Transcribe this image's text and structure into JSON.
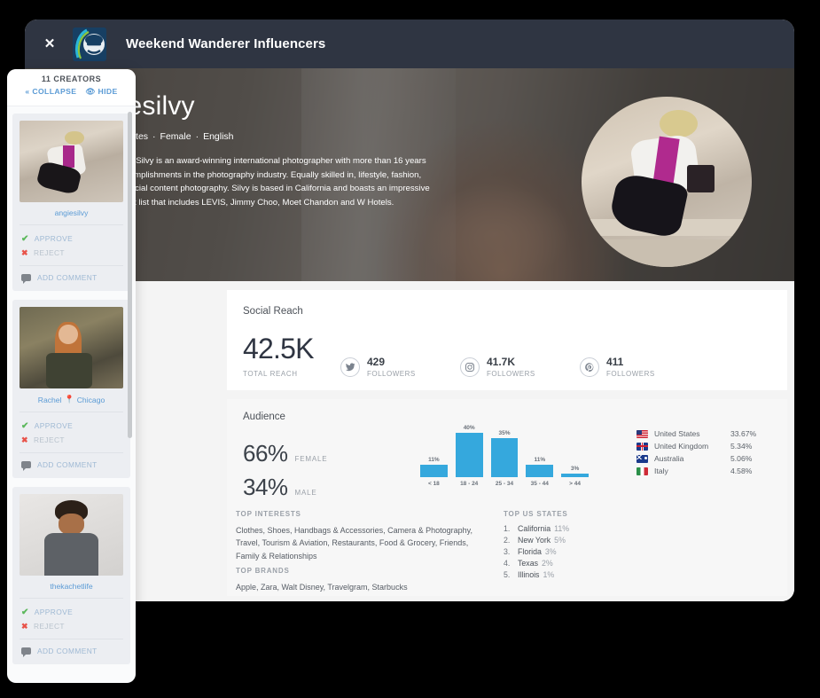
{
  "window": {
    "close_label": "✕",
    "title": "Weekend Wanderer Influencers"
  },
  "profile": {
    "name": "angiesilvy",
    "country": "United States",
    "gender": "Female",
    "language": "English",
    "sep": "·",
    "bio": "Australian born Silvy is an award-winning international photographer with more than 16 years of notable accomplishments in the photography industry. Equally skilled in, lifestyle, fashion, Interiors and social content photography. Silvy is based in California and boasts an impressive worldwide client list that includes LEVIS, Jimmy Choo, Moet Chandon and W Hotels."
  },
  "social_reach": {
    "title": "Social Reach",
    "total": "42.5K",
    "total_label": "TOTAL REACH",
    "stats": [
      {
        "icon": "twitter-icon",
        "value": "429",
        "label": "FOLLOWERS"
      },
      {
        "icon": "instagram-icon",
        "value": "41.7K",
        "label": "FOLLOWERS"
      },
      {
        "icon": "pinterest-icon",
        "value": "411",
        "label": "FOLLOWERS"
      }
    ]
  },
  "audience": {
    "title": "Audience",
    "female_pct": "66%",
    "female_label": "FEMALE",
    "male_pct": "34%",
    "male_label": "MALE",
    "countries": [
      {
        "flag": "us",
        "name": "United States",
        "pct": "33.67%"
      },
      {
        "flag": "uk",
        "name": "United Kingdom",
        "pct": "5.34%"
      },
      {
        "flag": "au",
        "name": "Australia",
        "pct": "5.06%"
      },
      {
        "flag": "it",
        "name": "Italy",
        "pct": "4.58%"
      }
    ]
  },
  "chart_data": {
    "type": "bar",
    "title": "",
    "xlabel": "",
    "ylabel": "",
    "categories": [
      "< 18",
      "18 - 24",
      "25 - 34",
      "35 - 44",
      "> 44"
    ],
    "values": [
      11,
      40,
      35,
      11,
      3
    ],
    "value_labels": [
      "11%",
      "40%",
      "35%",
      "11%",
      "3%"
    ],
    "ylim": [
      0,
      40
    ],
    "grid": false,
    "legend": "none",
    "color": "#35a8dd"
  },
  "interests": {
    "heading": "TOP INTERESTS",
    "body": "Clothes, Shoes, Handbags & Accessories, Camera & Photography, Travel, Tourism & Aviation, Restaurants, Food & Grocery, Friends, Family & Relationships"
  },
  "brands": {
    "heading": "TOP BRANDS",
    "body": "Apple, Zara, Walt Disney, Travelgram, Starbucks"
  },
  "us_states": {
    "heading": "TOP US STATES",
    "items": [
      {
        "rank": "1.",
        "name": "California",
        "pct": "11%"
      },
      {
        "rank": "2.",
        "name": "New York",
        "pct": "5%"
      },
      {
        "rank": "3.",
        "name": "Florida",
        "pct": "3%"
      },
      {
        "rank": "4.",
        "name": "Texas",
        "pct": "2%"
      },
      {
        "rank": "5.",
        "name": "Illinois",
        "pct": "1%"
      }
    ]
  },
  "creators_panel": {
    "count_label": "11 CREATORS",
    "collapse_label": "« COLLAPSE",
    "hide_label": "👁 HIDE",
    "approve_label": "APPROVE",
    "reject_label": "REJECT",
    "comment_label": "ADD COMMENT",
    "cards": [
      {
        "name": "angiesilvy",
        "location": ""
      },
      {
        "name": "Rachel",
        "location": "Chicago"
      },
      {
        "name": "thekachetlife",
        "location": ""
      }
    ]
  }
}
